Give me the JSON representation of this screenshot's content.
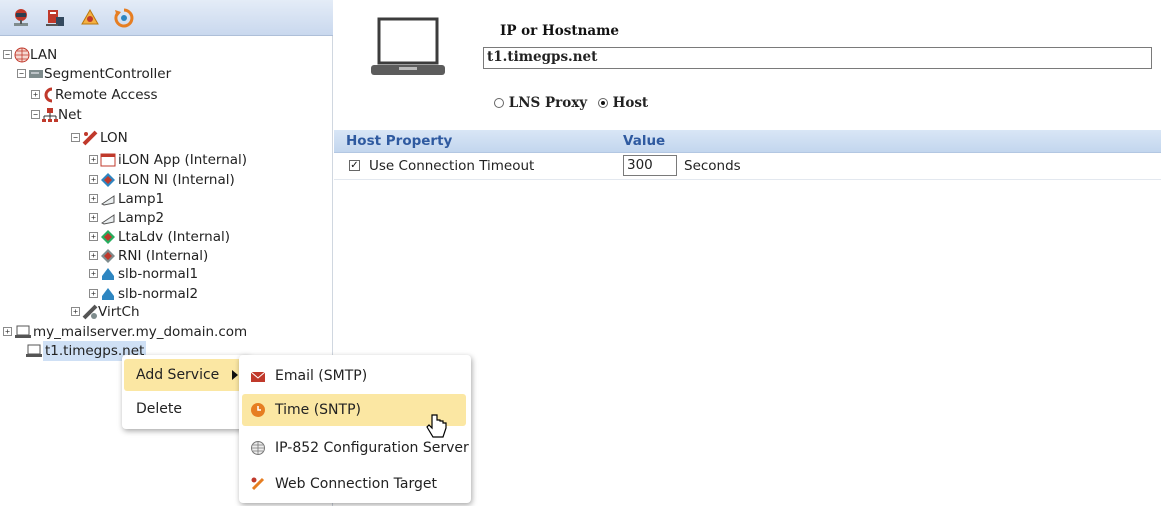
{
  "toolbar": {
    "icons": [
      "network-view-icon",
      "segment-controller-icon",
      "tools-icon",
      "refresh-icon"
    ]
  },
  "tree": {
    "lan": "LAN",
    "segment_controller": "SegmentController",
    "remote_access": "Remote Access",
    "net": "Net",
    "lon": "LON",
    "ilon_app": "iLON App (Internal)",
    "ilon_ni": "iLON NI (Internal)",
    "lamp1": "Lamp1",
    "lamp2": "Lamp2",
    "ltaldv": "LtaLdv (Internal)",
    "rni": "RNI (Internal)",
    "slb1": "slb-normal1",
    "slb2": "slb-normal2",
    "virtch": "VirtCh",
    "mailserver": "my_mailserver.my_domain.com",
    "timegps": "t1.timegps.net"
  },
  "host": {
    "label": "IP or Hostname",
    "value": "t1.timegps.net",
    "radio_lns": "LNS Proxy",
    "radio_host": "Host",
    "selected": "Host"
  },
  "property_table": {
    "col_property": "Host Property",
    "col_value": "Value",
    "row_label": "Use Connection Timeout",
    "row_checked": true,
    "row_value": "300",
    "row_unit": "Seconds"
  },
  "context_menu": {
    "add_service": "Add Service",
    "delete": "Delete"
  },
  "submenu": {
    "email": "Email (SMTP)",
    "time": "Time (SNTP)",
    "ip852": "IP-852 Configuration Server",
    "web": "Web Connection Target"
  },
  "colors": {
    "header_text": "#2f5aa0",
    "highlight": "#fbe7a3",
    "toolbar_bg": "#c9d8ee"
  }
}
